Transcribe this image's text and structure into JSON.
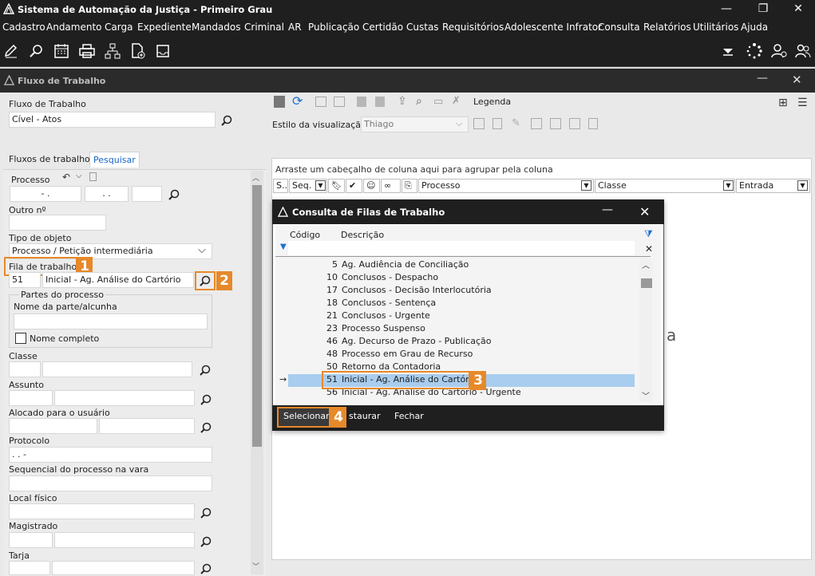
{
  "window": {
    "title": "Sistema de Automação da Justiça - Primeiro Grau"
  },
  "menu": [
    "Cadastro",
    "Andamento",
    "Carga",
    "Expediente",
    "Mandados",
    "Criminal",
    "AR",
    "Publicação",
    "Certidão",
    "Custas",
    "Requisitórios",
    "Adolescente Infrator",
    "Consulta",
    "Relatórios",
    "Utilitários",
    "Ajuda"
  ],
  "subwindow": {
    "title": "Fluxo de Trabalho"
  },
  "top": {
    "fluxo_label": "Fluxo de Trabalho",
    "fluxo_value": "Cível - Atos",
    "legenda": "Legenda",
    "estilo_label": "Estilo da visualização",
    "estilo_value": "Thiago"
  },
  "tabs": [
    "Fluxos de trabalho",
    "Pesquisar"
  ],
  "form": {
    "processo_label": "Processo",
    "processo_part1": "-  .",
    "processo_part2": ".  .",
    "outro_label": "Outro nº",
    "tipo_label": "Tipo de objeto",
    "tipo_value": "Processo / Petição intermediária",
    "fila_label": "Fila de trabalho",
    "fila_code": "51",
    "fila_desc": "Inicial - Ag. Análise do Cartório",
    "partes_label": "Partes do processo",
    "nome_label": "Nome da parte/alcunha",
    "nome_completo": "Nome completo",
    "classe_label": "Classe",
    "assunto_label": "Assunto",
    "alocado_label": "Alocado para o usuário",
    "protocolo_label": "Protocolo",
    "protocolo_value": ".  .  -",
    "sequencial_label": "Sequencial do processo na vara",
    "local_label": "Local físico",
    "magistrado_label": "Magistrado",
    "tarja_label": "Tarja"
  },
  "grid": {
    "group_hint": "Arraste um cabeçalho de coluna aqui para agrupar pela coluna",
    "columns": [
      "S...",
      "Seq.",
      "Processo",
      "Classe",
      "Entrada"
    ],
    "stray_text": "a"
  },
  "dialog": {
    "title": "Consulta de Filas de Trabalho",
    "col_codigo": "Código",
    "col_descricao": "Descrição",
    "rows": [
      {
        "code": "5",
        "desc": "Ag. Audiência de Conciliação"
      },
      {
        "code": "10",
        "desc": "Conclusos - Despacho"
      },
      {
        "code": "17",
        "desc": "Conclusos - Decisão Interlocutória"
      },
      {
        "code": "18",
        "desc": "Conclusos - Sentença"
      },
      {
        "code": "21",
        "desc": "Conclusos - Urgente"
      },
      {
        "code": "23",
        "desc": "Processo Suspenso"
      },
      {
        "code": "46",
        "desc": "Ag. Decurso de Prazo - Publicação"
      },
      {
        "code": "48",
        "desc": "Processo em Grau de Recurso"
      },
      {
        "code": "50",
        "desc": "Retorno da Contadoria"
      },
      {
        "code": "51",
        "desc": "Inicial - Ag. Análise do Cartório"
      },
      {
        "code": "56",
        "desc": "Inicial - Ag. Análise do Cartório - Urgente"
      }
    ],
    "selected_index": 9,
    "btn_selecionar": "Selecionar",
    "btn_restaurar": "staurar",
    "btn_fechar": "Fechar"
  },
  "callouts": [
    "1",
    "2",
    "3",
    "4"
  ],
  "colors": {
    "accent": "#e6892a",
    "selection": "#a9cdee",
    "link_tab": "#1464c8",
    "dark": "#1f1f1f"
  }
}
